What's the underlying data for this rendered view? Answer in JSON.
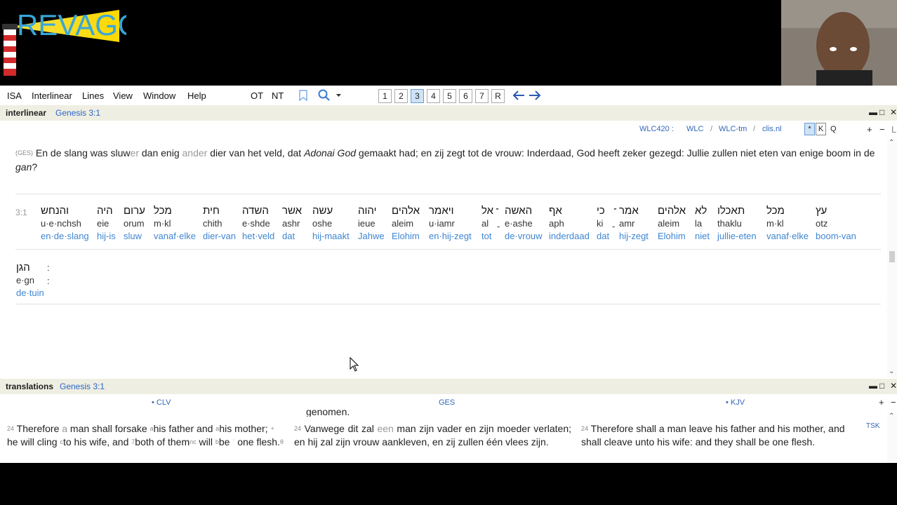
{
  "logo": {
    "text": "REVAGO"
  },
  "menu": {
    "items": [
      "ISA",
      "Interlinear",
      "Lines",
      "View",
      "Window",
      "Help"
    ],
    "ot": "OT",
    "nt": "NT",
    "pages": [
      "1",
      "2",
      "3",
      "4",
      "5",
      "6",
      "7",
      "R"
    ],
    "active_page": "3"
  },
  "interlinear_panel": {
    "title": "interlinear",
    "ref": "Genesis 3:1",
    "sources": {
      "wlc420": "WLC420 :",
      "wlc": "WLC",
      "wlctm": "WLC-tm",
      "clis": "clis.nl",
      "star": "*",
      "k": "K",
      "q": "Q",
      "plus": "+",
      "minus": "−",
      "l": "L"
    },
    "seps": [
      "/",
      "/"
    ],
    "verse_tag": "(GES)",
    "verse_parts": {
      "p1": "En de slang was sluw",
      "p1g": "er",
      "p2": " dan enig ",
      "p2g": "ander",
      "p3": " dier van het veld, dat ",
      "p3i": "Adonai God",
      "p4": " gemaakt had; en zij zegt tot de vrouw: Inderdaad, God heeft zeker gezegd: Jullie zullen niet eten van enige boom in de ",
      "p4i": "gan",
      "p5": "?"
    },
    "verse_num": "3:1",
    "words": [
      {
        "heb": "והנחש",
        "tr": "u·e·nchsh",
        "gl": "en·de·slang"
      },
      {
        "heb": "היה",
        "tr": "eie",
        "gl": "hij-is"
      },
      {
        "heb": "ערום",
        "tr": "orum",
        "gl": "sluw"
      },
      {
        "heb": "מכל",
        "tr": "m·kl",
        "gl": "vanaf·elke"
      },
      {
        "heb": "חית",
        "tr": "chith",
        "gl": "dier-van"
      },
      {
        "heb": "השדה",
        "tr": "e·shde",
        "gl": "het·veld"
      },
      {
        "heb": "אשר",
        "tr": "ashr",
        "gl": "dat"
      },
      {
        "heb": "עשה",
        "tr": "oshe",
        "gl": "hij-maakt"
      },
      {
        "heb": "יהוה",
        "tr": "ieue",
        "gl": "Jahwe"
      },
      {
        "heb": "אלהים",
        "tr": "aleim",
        "gl": "Elohim"
      },
      {
        "heb": "ויאמר",
        "tr": "u·iamr",
        "gl": "en·hij-zegt"
      },
      {
        "heb": "אל",
        "tr": "al",
        "gl": "tot"
      },
      {
        "heb": "האשה",
        "tr": "e·ashe",
        "gl": "de·vrouw"
      },
      {
        "heb": "אף",
        "tr": "aph",
        "gl": "inderdaad"
      },
      {
        "heb": "כי",
        "tr": "ki",
        "gl": "dat"
      },
      {
        "heb": "אמר",
        "tr": "amr",
        "gl": "hij-zegt"
      },
      {
        "heb": "אלהים",
        "tr": "aleim",
        "gl": "Elohim"
      },
      {
        "heb": "לא",
        "tr": "la",
        "gl": "niet"
      },
      {
        "heb": "תאכלו",
        "tr": "thaklu",
        "gl": "jullie-eten"
      },
      {
        "heb": "מכל",
        "tr": "m·kl",
        "gl": "vanaf·elke"
      },
      {
        "heb": "עץ",
        "tr": "otz",
        "gl": "boom-van"
      }
    ],
    "row2_word": {
      "heb": "הגן",
      "tr": "e·gn",
      "gl": "de·tuin"
    },
    "row2_punct": ":",
    "dashes": [
      "-",
      "-"
    ],
    "maqqef": [
      "־",
      "־"
    ]
  },
  "translations_panel": {
    "title": "translations",
    "ref": "Genesis 3:1",
    "columns": [
      "• CLV",
      "GES",
      "• KJV"
    ],
    "plus": "+",
    "minus": "−",
    "tsk": "TSK",
    "prev_line": "genomen.",
    "clv": {
      "num": "24",
      "t1": "Therefore ",
      "t1g": "a",
      "t2": " man shall forsake ",
      "t3": "his father and ",
      "t4": "his mother;",
      "t5": " he will cling ",
      "t6": "to his wife, and ",
      "t7": "both of them",
      "t8": " will ",
      "t9": "be",
      "t10": "one flesh.",
      "marks": [
        "a",
        "a",
        "+",
        "c",
        "7",
        "nc",
        "b",
        "ʾ",
        "θ"
      ]
    },
    "ges": {
      "num": "24",
      "t1": "Vanwege dit zal ",
      "t1g": "een",
      "t2": " man zijn vader en zijn moeder verlaten; en hij zal zijn vrouw aankleven, en zij zullen één vlees zijn."
    },
    "kjv": {
      "num": "24",
      "text": "Therefore shall a man leave his father and his mother, and shall cleave unto his wife: and they shall be one flesh."
    }
  }
}
